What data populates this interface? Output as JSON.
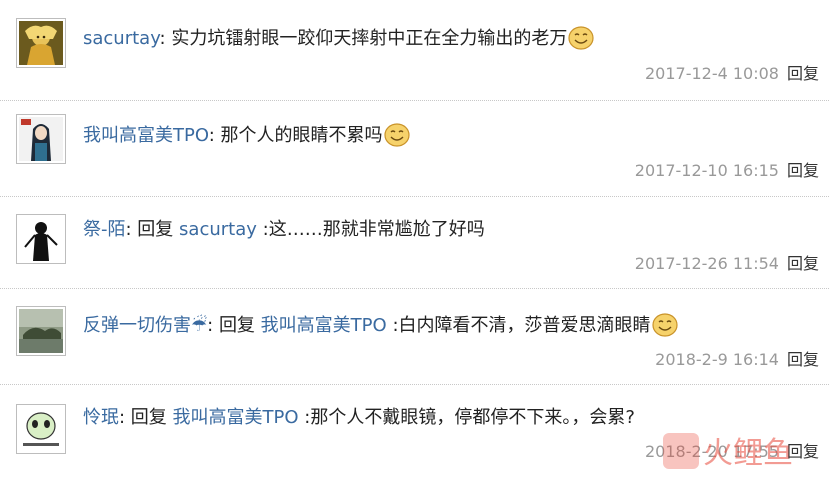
{
  "comments": [
    {
      "user": "sacurtay",
      "reply_word": "",
      "reply_to": "",
      "text": "实力坑镭射眼一跤仰天摔射中正在全力输出的老万",
      "has_emoji": true,
      "date": "2017-12-4 10:08",
      "reply_label": "回复",
      "avatar_icon": "golden-armor-avatar-icon"
    },
    {
      "user": "我叫高富美TPO",
      "reply_word": "",
      "reply_to": "",
      "text": "那个人的眼睛不累吗",
      "has_emoji": true,
      "date": "2017-12-10 16:15",
      "reply_label": "回复",
      "avatar_icon": "anime-character-avatar-icon"
    },
    {
      "user": "祭-陌",
      "reply_word": "回复",
      "reply_to": "sacurtay",
      "text": ":这……那就非常尴尬了好吗",
      "has_emoji": false,
      "date": "2017-12-26 11:54",
      "reply_label": "回复",
      "avatar_icon": "silhouette-avatar-icon"
    },
    {
      "user": "反弹一切伤害☔",
      "reply_word": "回复",
      "reply_to": "我叫高富美TPO",
      "text": ":白内障看不清，莎普爱思滴眼睛",
      "has_emoji": true,
      "date": "2018-2-9 16:14",
      "reply_label": "回复",
      "avatar_icon": "lake-landscape-avatar-icon"
    },
    {
      "user": "怜珉",
      "reply_word": "回复",
      "reply_to": "我叫高富美TPO",
      "text": ":那个人不戴眼镜，停都停不下来。，会累?",
      "has_emoji": false,
      "date": "2018-2-20 17:55",
      "reply_label": "回复",
      "avatar_icon": "cartoon-face-avatar-icon"
    }
  ],
  "watermark_text": "火鲤鱼",
  "colors": {
    "username": "#3a6aa0",
    "meta": "#999999",
    "text": "#222222"
  }
}
